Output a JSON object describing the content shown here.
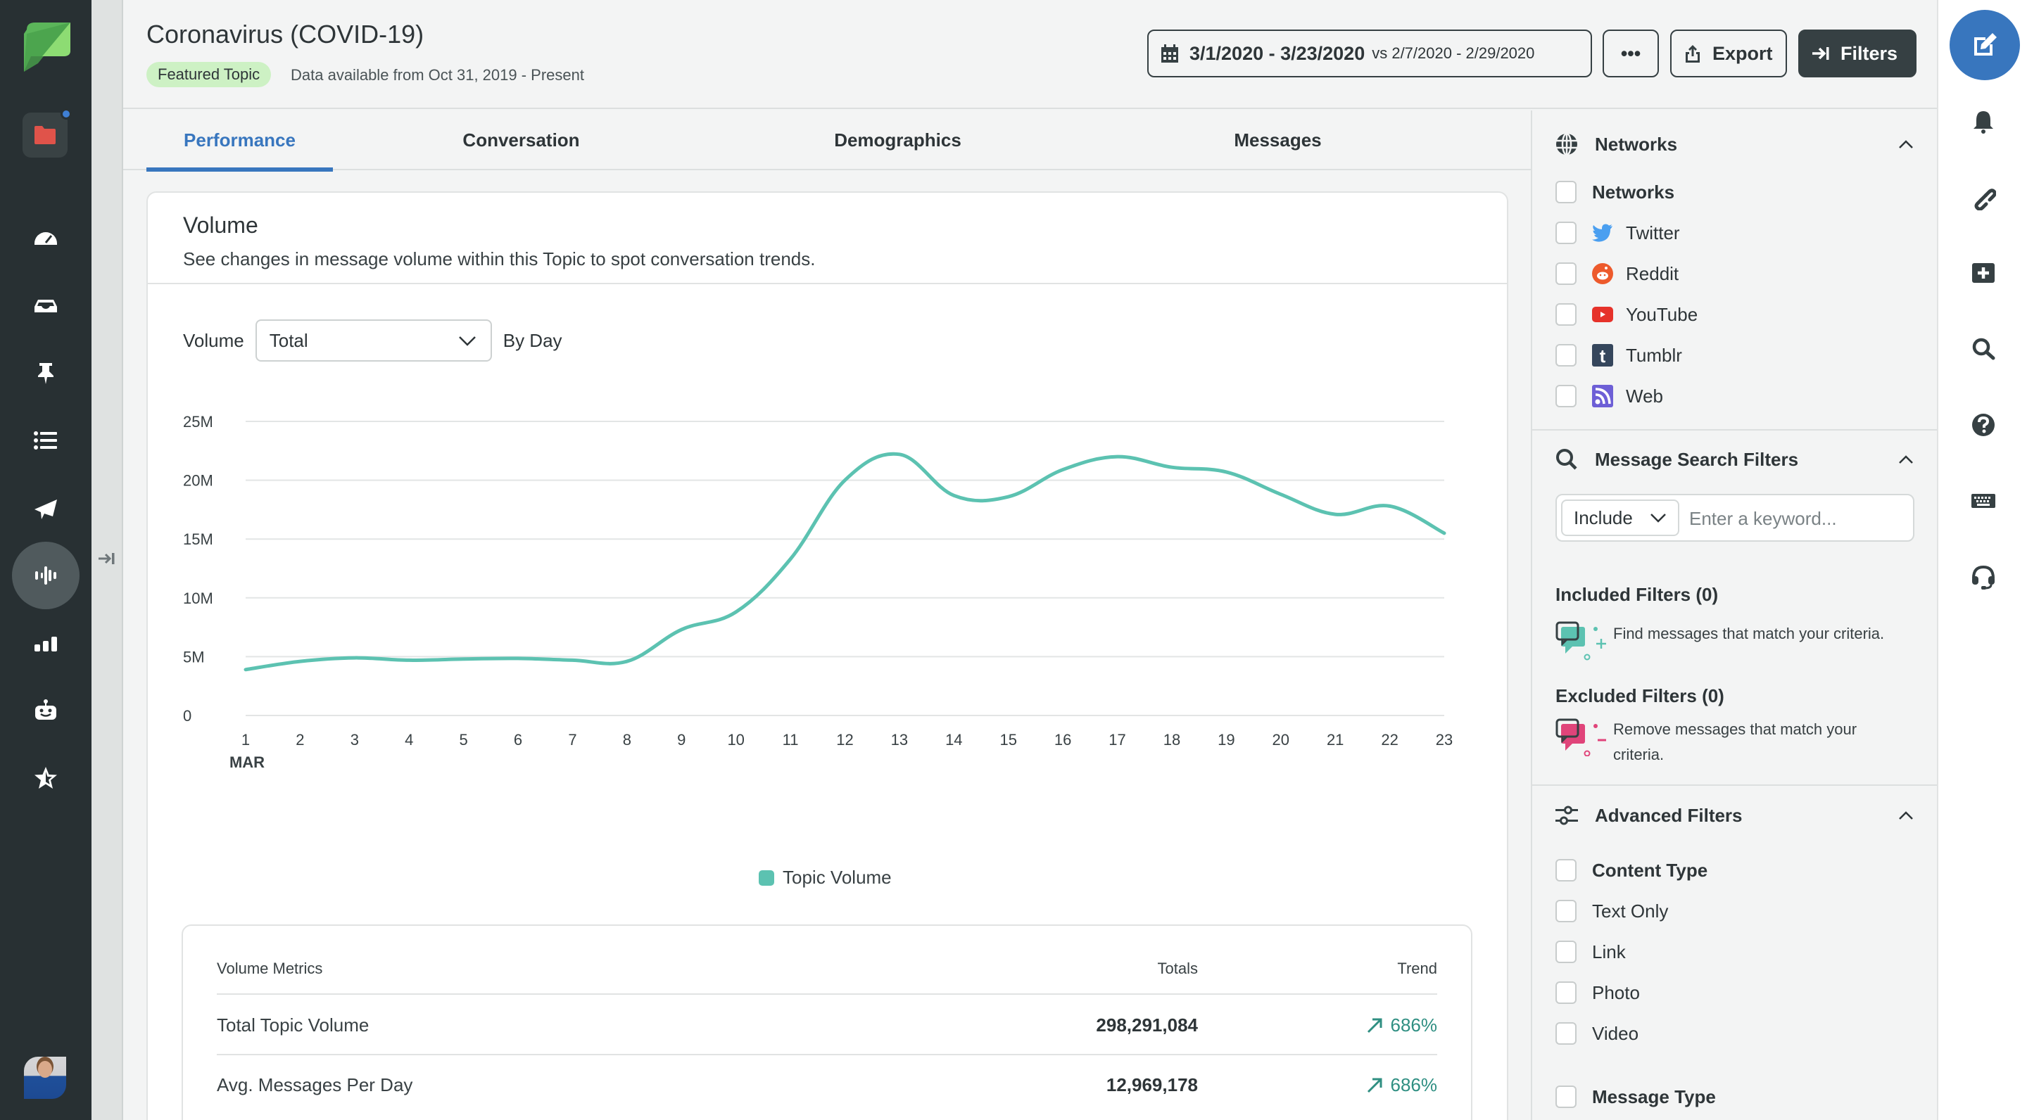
{
  "nav": {
    "items": [
      {
        "name": "dashboard",
        "label": "Dashboard"
      },
      {
        "name": "inbox",
        "label": "Inbox"
      },
      {
        "name": "tasks",
        "label": "Tasks"
      },
      {
        "name": "feeds",
        "label": "Feeds"
      },
      {
        "name": "publishing",
        "label": "Publishing"
      },
      {
        "name": "listening",
        "label": "Listening",
        "active": true
      },
      {
        "name": "reports",
        "label": "Reports"
      },
      {
        "name": "bots",
        "label": "Bots"
      },
      {
        "name": "reviews",
        "label": "Reviews"
      }
    ],
    "notification_dot": true
  },
  "header": {
    "title": "Coronavirus (COVID-19)",
    "badge": "Featured Topic",
    "data_available": "Data available from Oct 31, 2019 - Present",
    "date_range": "3/1/2020 - 3/23/2020",
    "compare_label": "vs 2/7/2020 - 2/29/2020",
    "more_label": "•••",
    "export_label": "Export",
    "filters_label": "Filters"
  },
  "tabs": [
    {
      "label": "Performance",
      "active": true
    },
    {
      "label": "Conversation",
      "active": false
    },
    {
      "label": "Demographics",
      "active": false
    },
    {
      "label": "Messages",
      "active": false
    }
  ],
  "volume_card": {
    "title": "Volume",
    "subtitle": "See changes in message volume within this Topic to spot conversation trends.",
    "volume_label": "Volume",
    "select_value": "Total",
    "period_label": "By Day",
    "legend_label": "Topic Volume"
  },
  "chart_data": {
    "type": "line",
    "title": "Volume",
    "xlabel": "MAR",
    "ylabel": "",
    "x": [
      1,
      2,
      3,
      4,
      5,
      6,
      7,
      8,
      9,
      10,
      11,
      12,
      13,
      14,
      15,
      16,
      17,
      18,
      19,
      20,
      21,
      22,
      23
    ],
    "x_tick_labels": [
      "1",
      "2",
      "3",
      "4",
      "5",
      "6",
      "7",
      "8",
      "9",
      "10",
      "11",
      "12",
      "13",
      "14",
      "15",
      "16",
      "17",
      "18",
      "19",
      "20",
      "21",
      "22",
      "23"
    ],
    "y_tick_labels": [
      "0",
      "5M",
      "10M",
      "15M",
      "20M",
      "25M"
    ],
    "y_ticks": [
      0,
      5000000,
      10000000,
      15000000,
      20000000,
      25000000
    ],
    "ylim": [
      0,
      25000000
    ],
    "grid": true,
    "legend_position": "bottom-center",
    "series": [
      {
        "name": "Topic Volume",
        "color": "#5cc2b1",
        "values": [
          3900000,
          4600000,
          4900000,
          4700000,
          4800000,
          4850000,
          4700000,
          4600000,
          7300000,
          8800000,
          13300000,
          20000000,
          22200000,
          18700000,
          18600000,
          20900000,
          22000000,
          21100000,
          20700000,
          18800000,
          17100000,
          17800000,
          15500000
        ]
      }
    ]
  },
  "metrics": {
    "headers": {
      "name": "Volume Metrics",
      "total": "Totals",
      "trend": "Trend"
    },
    "rows": [
      {
        "name": "Total Topic Volume",
        "total": "298,291,084",
        "trend": "686%",
        "trend_direction": "up"
      },
      {
        "name": "Avg. Messages Per Day",
        "total": "12,969,178",
        "trend": "686%",
        "trend_direction": "up"
      }
    ]
  },
  "filters": {
    "networks": {
      "title": "Networks",
      "all_label": "Networks",
      "items": [
        {
          "label": "Twitter",
          "icon": "twitter-icon",
          "color": "#4a9ff0",
          "checked": false
        },
        {
          "label": "Reddit",
          "icon": "reddit-icon",
          "color": "#ed5a2c",
          "checked": false
        },
        {
          "label": "YouTube",
          "icon": "youtube-icon",
          "color": "#e6322a",
          "checked": false
        },
        {
          "label": "Tumblr",
          "icon": "tumblr-icon",
          "color": "#35465c",
          "checked": false
        },
        {
          "label": "Web",
          "icon": "rss-icon",
          "color": "#6d5fd6",
          "checked": false
        }
      ]
    },
    "search": {
      "title": "Message Search Filters",
      "mode": "Include",
      "placeholder": "Enter a keyword...",
      "included_title": "Included Filters (0)",
      "included_hint": "Find messages that match your criteria.",
      "excluded_title": "Excluded Filters (0)",
      "excluded_hint": "Remove messages that match your criteria."
    },
    "advanced": {
      "title": "Advanced Filters",
      "content_type_label": "Content Type",
      "content_types": [
        "Text Only",
        "Link",
        "Photo",
        "Video"
      ],
      "message_type_label": "Message Type"
    }
  },
  "rightbar": {
    "items": [
      "compose",
      "notifications",
      "link",
      "add",
      "search",
      "help",
      "keyboard-shortcuts",
      "support"
    ]
  }
}
